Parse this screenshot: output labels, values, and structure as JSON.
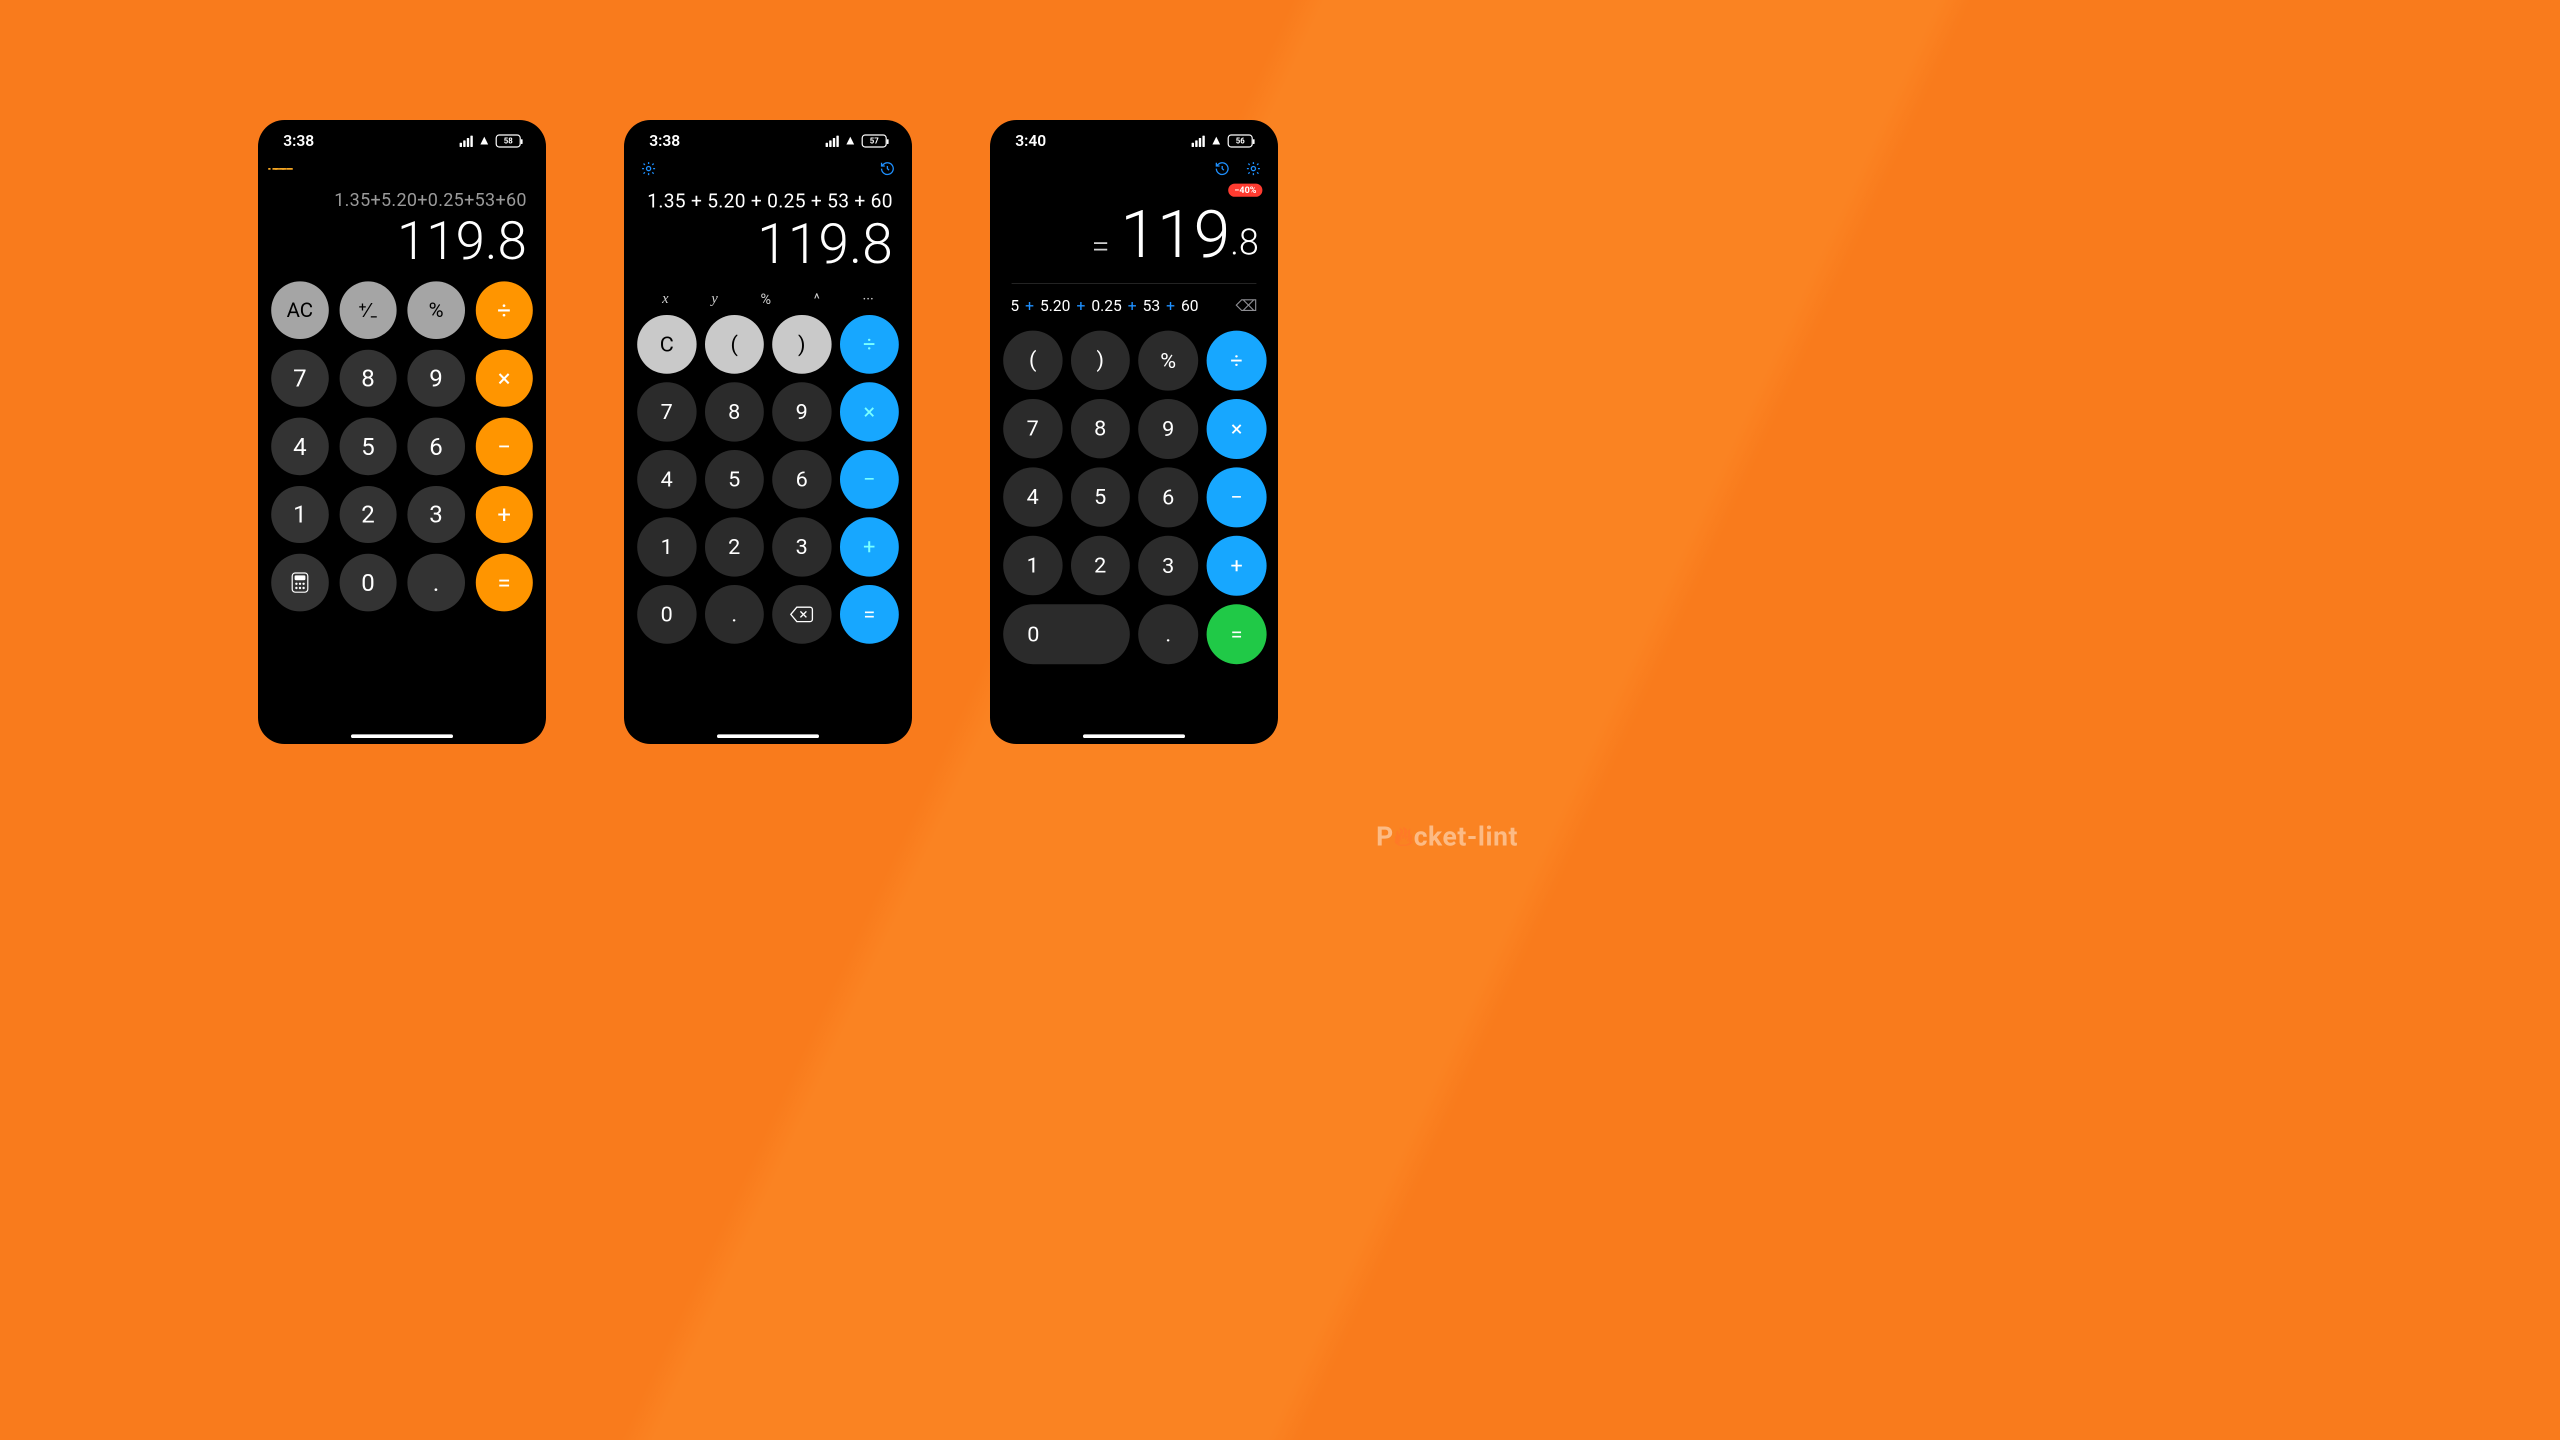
{
  "watermark_pre": "P",
  "watermark_mid": "cket-lint",
  "phoneA": {
    "time": "3:38",
    "battery": "58",
    "expr": "1.35+5.20+0.25+53+60",
    "result": "119.8",
    "keys": {
      "ac": "AC",
      "sign": "⁺∕₋",
      "pct": "%",
      "div": "÷",
      "k7": "7",
      "k8": "8",
      "k9": "9",
      "mul": "×",
      "k4": "4",
      "k5": "5",
      "k6": "6",
      "sub": "−",
      "k1": "1",
      "k2": "2",
      "k3": "3",
      "add": "+",
      "calc": "🖩",
      "k0": "0",
      "dot": ".",
      "eq": "="
    }
  },
  "phoneB": {
    "time": "3:38",
    "battery": "57",
    "expr": "1.35 + 5.20 + 0.25 + 53 + 60",
    "result": "119.8",
    "xrow": {
      "x": "x",
      "y": "y",
      "pct": "%",
      "pow": "^",
      "more": "···"
    },
    "keys": {
      "c": "C",
      "lp": "(",
      "rp": ")",
      "div": "÷",
      "k7": "7",
      "k8": "8",
      "k9": "9",
      "mul": "×",
      "k4": "4",
      "k5": "5",
      "k6": "6",
      "sub": "−",
      "k1": "1",
      "k2": "2",
      "k3": "3",
      "add": "+",
      "k0": "0",
      "dot": ".",
      "eq": "="
    }
  },
  "phoneC": {
    "time": "3:40",
    "battery": "56",
    "badge": "−40%",
    "result_eq": "=",
    "result_int": "119",
    "result_dec": ".8",
    "expr_tokens": [
      "5",
      "+",
      "5.20",
      "+",
      "0.25",
      "+",
      "53",
      "+",
      "60"
    ],
    "keys": {
      "lp": "(",
      "rp": ")",
      "pct": "%",
      "div": "÷",
      "k7": "7",
      "k8": "8",
      "k9": "9",
      "mul": "×",
      "k4": "4",
      "k5": "5",
      "k6": "6",
      "sub": "−",
      "k1": "1",
      "k2": "2",
      "k3": "3",
      "add": "+",
      "k0": "0",
      "dot": ".",
      "eq": "="
    }
  }
}
